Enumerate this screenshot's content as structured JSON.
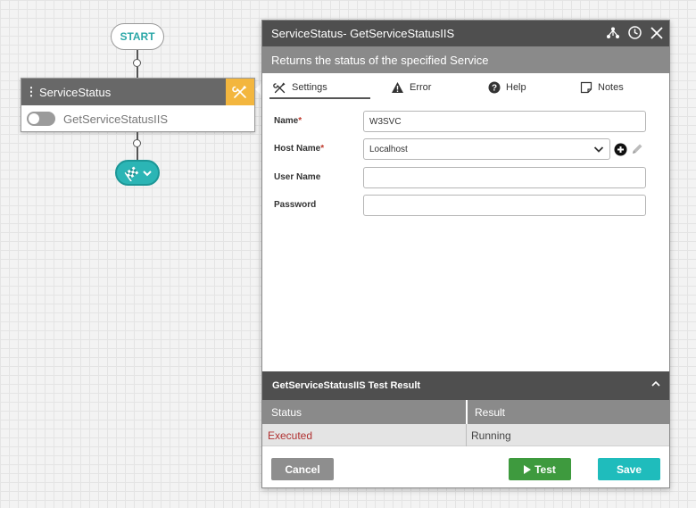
{
  "flow": {
    "start_label": "START",
    "activity": {
      "title": "ServiceStatus",
      "action_label": "GetServiceStatusIIS",
      "toggle_on": false
    }
  },
  "panel": {
    "title": "ServiceStatus-  GetServiceStatusIIS",
    "description": "Returns the status of the specified Service",
    "tabs": [
      {
        "label": "Settings",
        "icon": "tools-icon",
        "active": true
      },
      {
        "label": "Error",
        "icon": "warning-icon",
        "active": false
      },
      {
        "label": "Help",
        "icon": "help-icon",
        "active": false
      },
      {
        "label": "Notes",
        "icon": "notes-icon",
        "active": false
      }
    ],
    "form": {
      "name_label": "Name",
      "name_value": "W3SVC",
      "host_label": "Host Name",
      "host_value": "Localhost",
      "user_label": "User Name",
      "user_value": "",
      "password_label": "Password",
      "password_value": "",
      "required_mark": "*"
    },
    "result": {
      "title": "GetServiceStatusIIS Test Result",
      "columns": [
        "Status",
        "Result"
      ],
      "rows": [
        {
          "status": "Executed",
          "result": "Running"
        }
      ]
    },
    "buttons": {
      "cancel": "Cancel",
      "test": "Test",
      "save": "Save"
    }
  },
  "colors": {
    "accent_teal": "#1fbcbc",
    "test_green": "#3e9a3e",
    "tool_orange": "#f3b63e",
    "header_dark": "#4f4f4f",
    "status_red": "#b03030"
  }
}
